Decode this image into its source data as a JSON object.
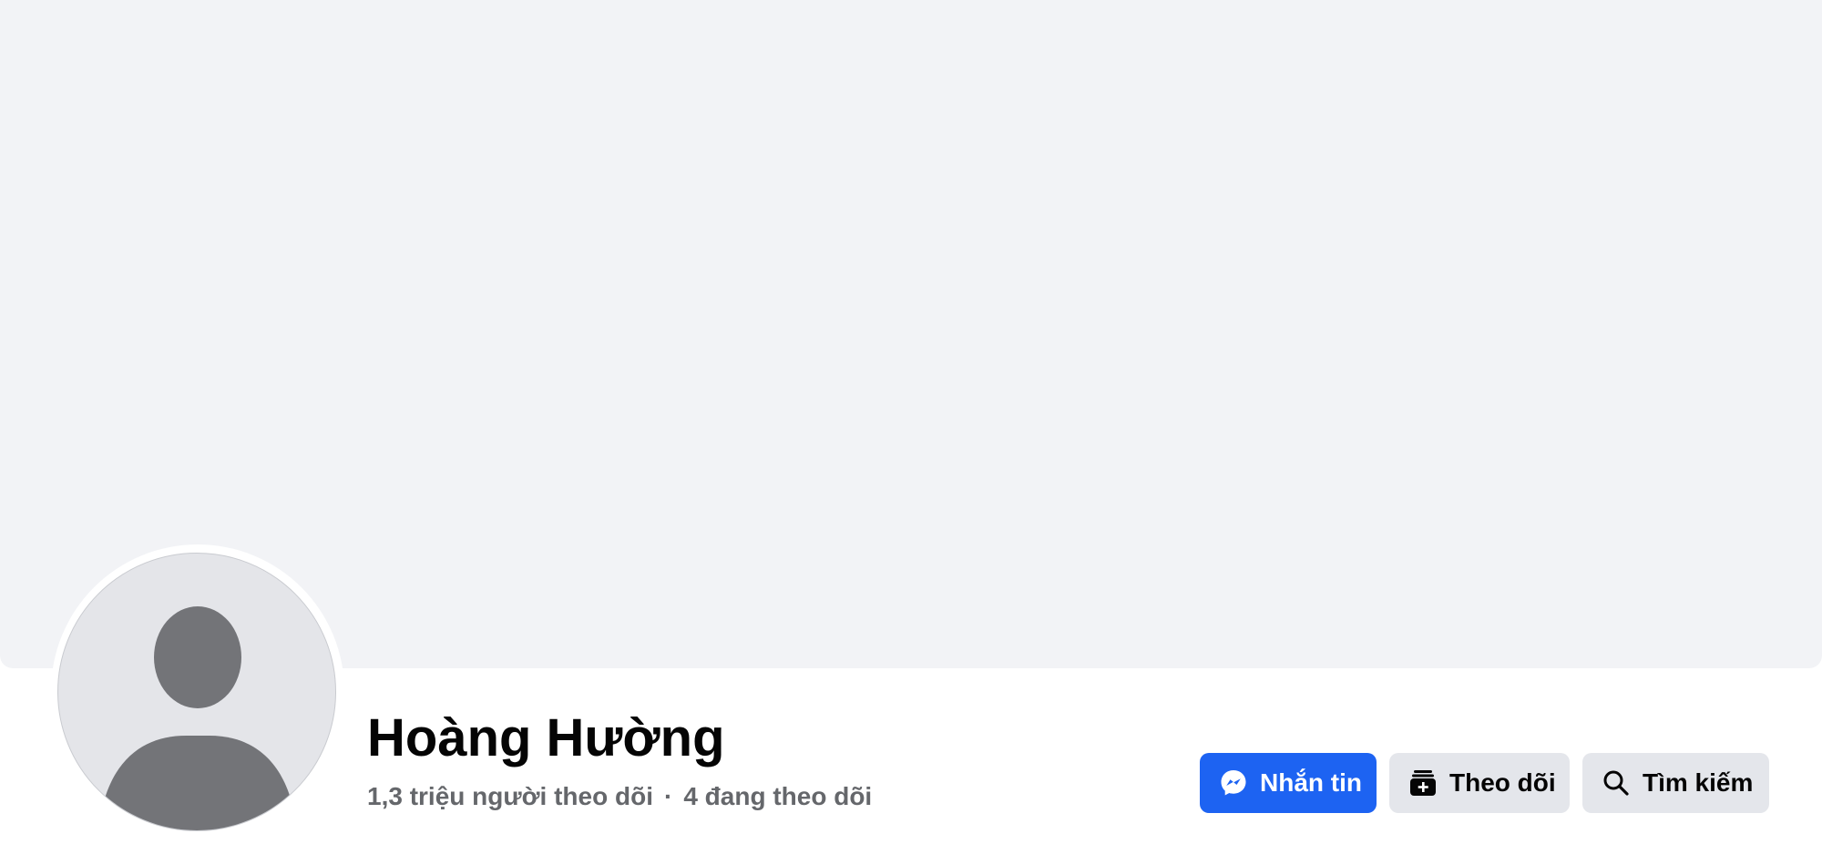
{
  "profile": {
    "name": "Hoàng Hường",
    "followers_text": "1,3 triệu người theo dõi",
    "separator": "·",
    "following_text": "4 đang theo dõi",
    "avatar_icon": "default-person-icon"
  },
  "actions": {
    "message_label": "Nhắn tin",
    "message_icon": "messenger-icon",
    "follow_label": "Theo dõi",
    "follow_icon": "follow-add-icon",
    "search_label": "Tìm kiếm",
    "search_icon": "search-icon"
  },
  "colors": {
    "primary_button": "#1d63f2",
    "secondary_button": "#e4e6eb",
    "cover": "#f2f3f6",
    "secondary_text": "#65676b"
  }
}
